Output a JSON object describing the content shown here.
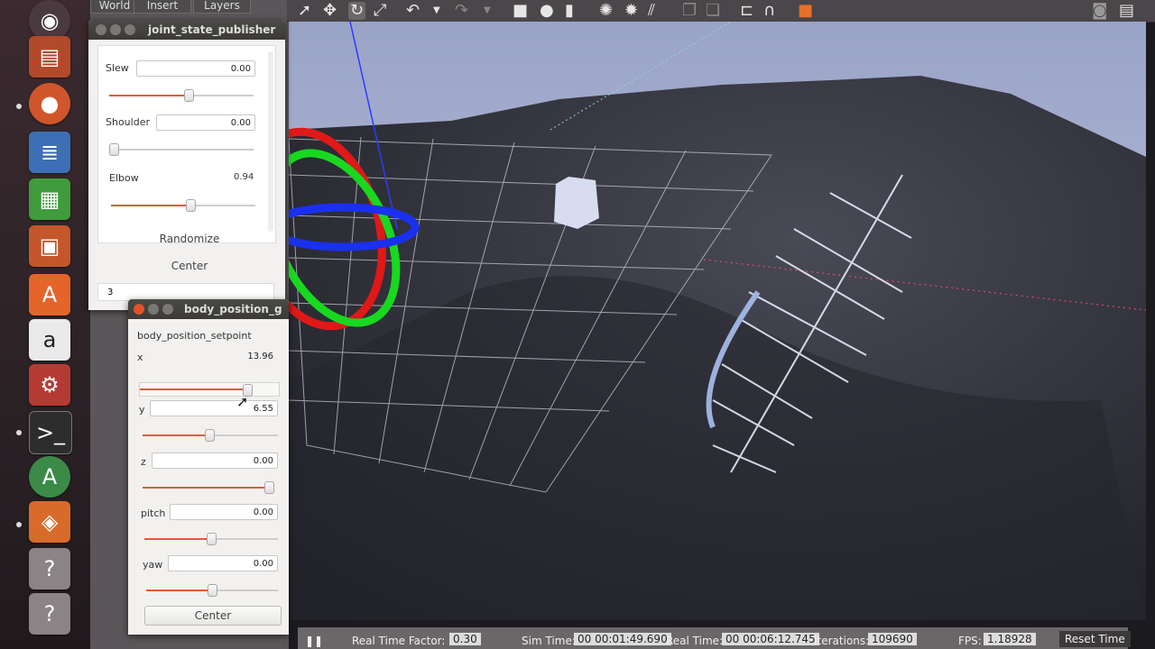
{
  "dock": {
    "tabs": [
      "World",
      "Insert",
      "Layers"
    ]
  },
  "toolbar": {
    "icons": [
      "select-arrow-icon",
      "move-icon",
      "rotate-icon",
      "scale-icon",
      "undo-icon",
      "undo-menu-icon",
      "redo-icon",
      "redo-menu-icon",
      "box-icon",
      "sphere-icon",
      "cylinder-icon",
      "point-light-icon",
      "spot-light-icon",
      "directional-light-icon",
      "copy-icon",
      "paste-icon",
      "align-icon",
      "snap-icon",
      "color-icon",
      "screenshot-icon",
      "log-icon"
    ]
  },
  "joint_state_publisher": {
    "title": "joint_state_publisher",
    "sliders": [
      {
        "label": "Slew",
        "value": "0.00",
        "level": 0.55
      },
      {
        "label": "Shoulder",
        "value": "0.00",
        "level": 0.0
      },
      {
        "label": "Elbow",
        "value": "0.94",
        "level": 0.55
      }
    ],
    "randomize": "Randomize",
    "center": "Center",
    "count_value": "3"
  },
  "body_position": {
    "title": "body_position_g",
    "heading": "body_position_setpoint",
    "sliders": [
      {
        "label": "x",
        "value": "13.96",
        "level": 0.76
      },
      {
        "label": "y",
        "value": "6.55",
        "level": 0.49
      },
      {
        "label": "z",
        "value": "0.00",
        "level": 1.0
      },
      {
        "label": "pitch",
        "value": "0.00",
        "level": 0.5
      },
      {
        "label": "yaw",
        "value": "0.00",
        "level": 0.5
      }
    ],
    "center": "Center"
  },
  "status": {
    "rtf_label": "Real Time Factor:",
    "rtf_value": "0.30",
    "sim_label": "Sim Time:",
    "sim_value": "00 00:01:49.690",
    "real_label": "Real Time:",
    "real_value": "00 00:06:12.745",
    "iter_label": "Iterations:",
    "iter_value": "109690",
    "fps_label": "FPS:",
    "fps_value": "1.18928",
    "reset": "Reset Time"
  },
  "colors": {
    "accent": "#e0593b",
    "title_bar": "#3b3a37",
    "close": "#e0542b"
  }
}
